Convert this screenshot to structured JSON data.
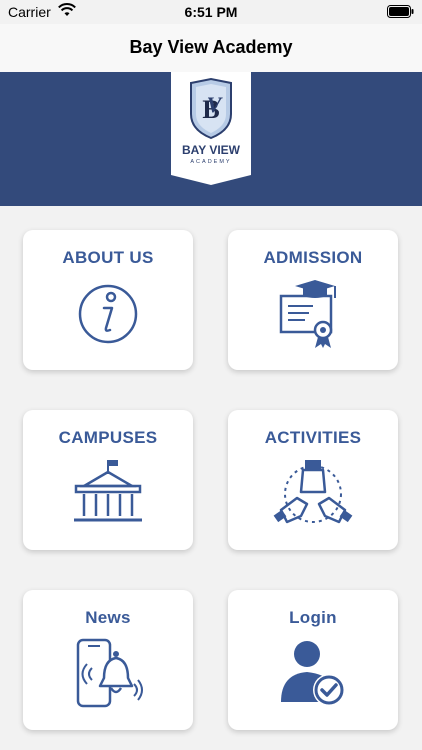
{
  "status_bar": {
    "carrier": "Carrier",
    "time": "6:51 PM",
    "icons": [
      "wifi-icon",
      "battery-icon"
    ]
  },
  "nav": {
    "title": "Bay View Academy"
  },
  "banner": {
    "background": "#334a7b",
    "logo_line1": "BAY VIEW",
    "logo_line2": "ACADEMY"
  },
  "accent_color": "#3a5a98",
  "menu": {
    "items": [
      {
        "label": "ABOUT US",
        "icon": "info-icon"
      },
      {
        "label": "ADMISSION",
        "icon": "diploma-icon"
      },
      {
        "label": "CAMPUSES",
        "icon": "building-icon"
      },
      {
        "label": "ACTIVITIES",
        "icon": "teamwork-hands-icon"
      },
      {
        "label": "News",
        "icon": "phone-notification-icon"
      },
      {
        "label": "Login",
        "icon": "user-check-icon"
      }
    ]
  }
}
